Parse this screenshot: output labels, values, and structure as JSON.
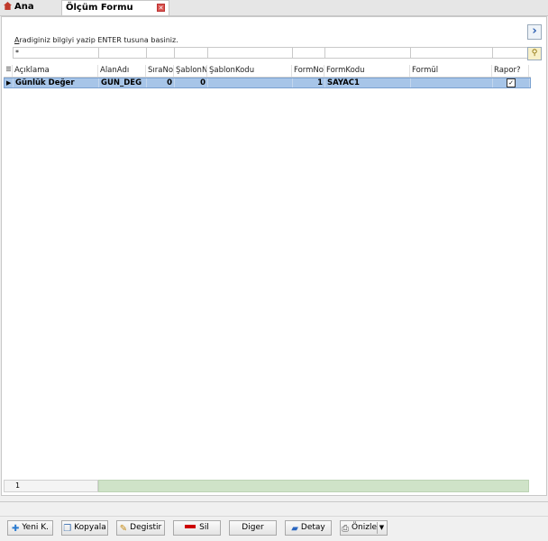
{
  "tabs": [
    {
      "label": "Ana Ekran"
    },
    {
      "label": "Ölçüm Formu Alanları"
    }
  ],
  "search": {
    "hint_prefix": "A",
    "hint_rest": "radiginiz bilgiyi yazip ENTER tusuna basiniz.",
    "filter_value": "*"
  },
  "grid": {
    "columns": [
      "Açıklama",
      "AlanAdı",
      "SıraNo",
      "ŞablonN",
      "ŞablonKodu",
      "FormNo",
      "FormKodu",
      "Formül",
      "Rapor?"
    ],
    "rows": [
      {
        "aciklama": "Günlük Değer",
        "alanadi": "GUN_DEG",
        "sirano": "0",
        "sablonno": "0",
        "sablonkodu": "",
        "formno": "1",
        "formkodu": "SAYAC1",
        "formul": "",
        "rapor": true
      }
    ],
    "record_count": "1"
  },
  "toolbar": {
    "new_label": "Yeni K.",
    "copy_label": "Kopyala",
    "edit_label": "Degistir",
    "delete_label": "Sil",
    "other_label": "Diger",
    "detail_label": "Detay",
    "preview_label": "Önizle"
  },
  "icons": {
    "home": "home-icon",
    "close": "close-icon",
    "next": "chevron-right-icon",
    "filter": "filter-icon"
  }
}
